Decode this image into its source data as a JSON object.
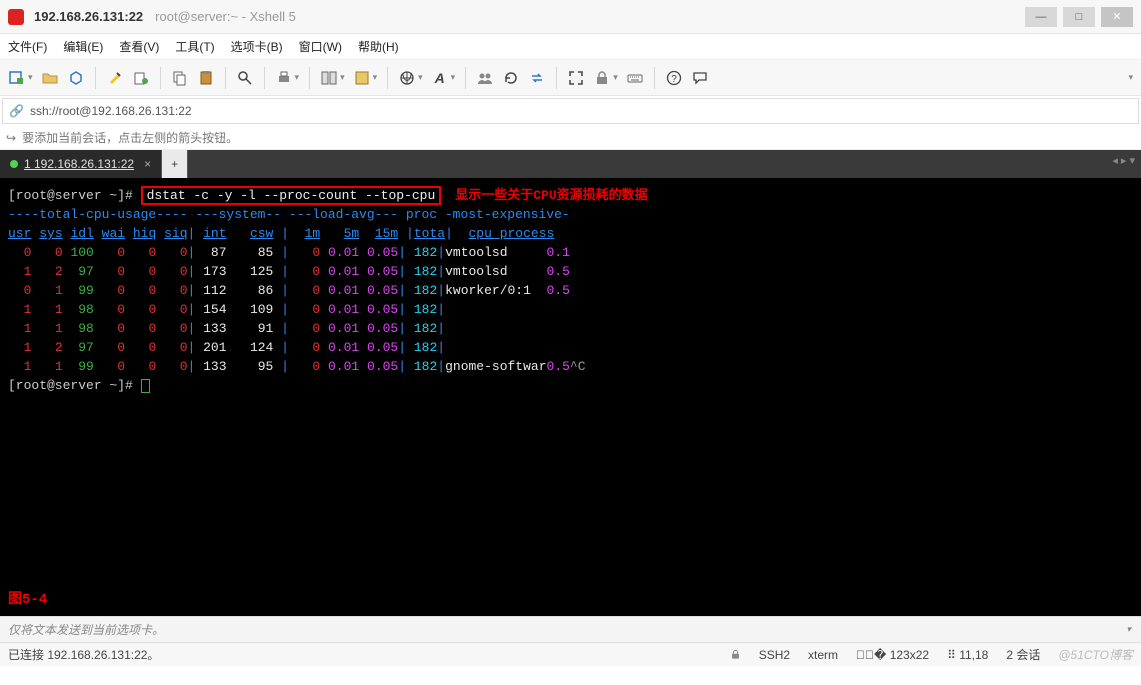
{
  "title": {
    "host": "192.168.26.131:22",
    "app": "root@server:~ - Xshell 5"
  },
  "menu": {
    "file": "文件(F)",
    "edit": "编辑(E)",
    "view": "查看(V)",
    "tools": "工具(T)",
    "tabs": "选项卡(B)",
    "window": "窗口(W)",
    "help": "帮助(H)"
  },
  "address": "ssh://root@192.168.26.131:22",
  "tip": "要添加当前会话，点击左侧的箭头按钮。",
  "tab": {
    "label": "1 192.168.26.131:22"
  },
  "terminal": {
    "prompt": "[root@server ~]# ",
    "command": "dstat -c -y -l --proc-count --top-cpu",
    "annotation": "显示一些关于CPU资源损耗的数据",
    "header_groups": "----total-cpu-usage---- ---system-- ---load-avg--- proc -most-expensive-",
    "headers": {
      "usr": "usr",
      "sys": "sys",
      "idl": "idl",
      "wai": "wai",
      "hiq": "hiq",
      "siq": "siq",
      "int": "int",
      "csw": "csw",
      "l1m": "1m",
      "l5m": "5m",
      "l15m": "15m",
      "tota": "tota",
      "cpu_proc": "cpu process"
    },
    "rows": [
      {
        "usr": "0",
        "sys": "0",
        "idl": "100",
        "wai": "0",
        "hiq": "0",
        "siq": "0",
        "int": "87",
        "csw": "85",
        "l1": "0",
        "l5": "0.01",
        "l15": "0.05",
        "tota": "182",
        "proc": "vmtoolsd",
        "pv": "0.1"
      },
      {
        "usr": "1",
        "sys": "2",
        "idl": "97",
        "wai": "0",
        "hiq": "0",
        "siq": "0",
        "int": "173",
        "csw": "125",
        "l1": "0",
        "l5": "0.01",
        "l15": "0.05",
        "tota": "182",
        "proc": "vmtoolsd",
        "pv": "0.5"
      },
      {
        "usr": "0",
        "sys": "1",
        "idl": "99",
        "wai": "0",
        "hiq": "0",
        "siq": "0",
        "int": "112",
        "csw": "86",
        "l1": "0",
        "l5": "0.01",
        "l15": "0.05",
        "tota": "182",
        "proc": "kworker/0:1",
        "pv": "0.5"
      },
      {
        "usr": "1",
        "sys": "1",
        "idl": "98",
        "wai": "0",
        "hiq": "0",
        "siq": "0",
        "int": "154",
        "csw": "109",
        "l1": "0",
        "l5": "0.01",
        "l15": "0.05",
        "tota": "182",
        "proc": "",
        "pv": ""
      },
      {
        "usr": "1",
        "sys": "1",
        "idl": "98",
        "wai": "0",
        "hiq": "0",
        "siq": "0",
        "int": "133",
        "csw": "91",
        "l1": "0",
        "l5": "0.01",
        "l15": "0.05",
        "tota": "182",
        "proc": "",
        "pv": ""
      },
      {
        "usr": "1",
        "sys": "2",
        "idl": "97",
        "wai": "0",
        "hiq": "0",
        "siq": "0",
        "int": "201",
        "csw": "124",
        "l1": "0",
        "l5": "0.01",
        "l15": "0.05",
        "tota": "182",
        "proc": "",
        "pv": ""
      },
      {
        "usr": "1",
        "sys": "1",
        "idl": "99",
        "wai": "0",
        "hiq": "0",
        "siq": "0",
        "int": "133",
        "csw": "95",
        "l1": "0",
        "l5": "0.01",
        "l15": "0.05",
        "tota": "182",
        "proc": "gnome-softwar",
        "pv": "0.5",
        "tail": "^C"
      }
    ],
    "figure_label": "图5-4"
  },
  "sendbar": "仅将文本发送到当前选项卡。",
  "status": {
    "conn": "已连接 192.168.26.131:22。",
    "proto": "SSH2",
    "term": "xterm",
    "size": "123x22",
    "cursor": "11,18",
    "sess": "2 会话",
    "watermark": "@51CTO博客"
  }
}
